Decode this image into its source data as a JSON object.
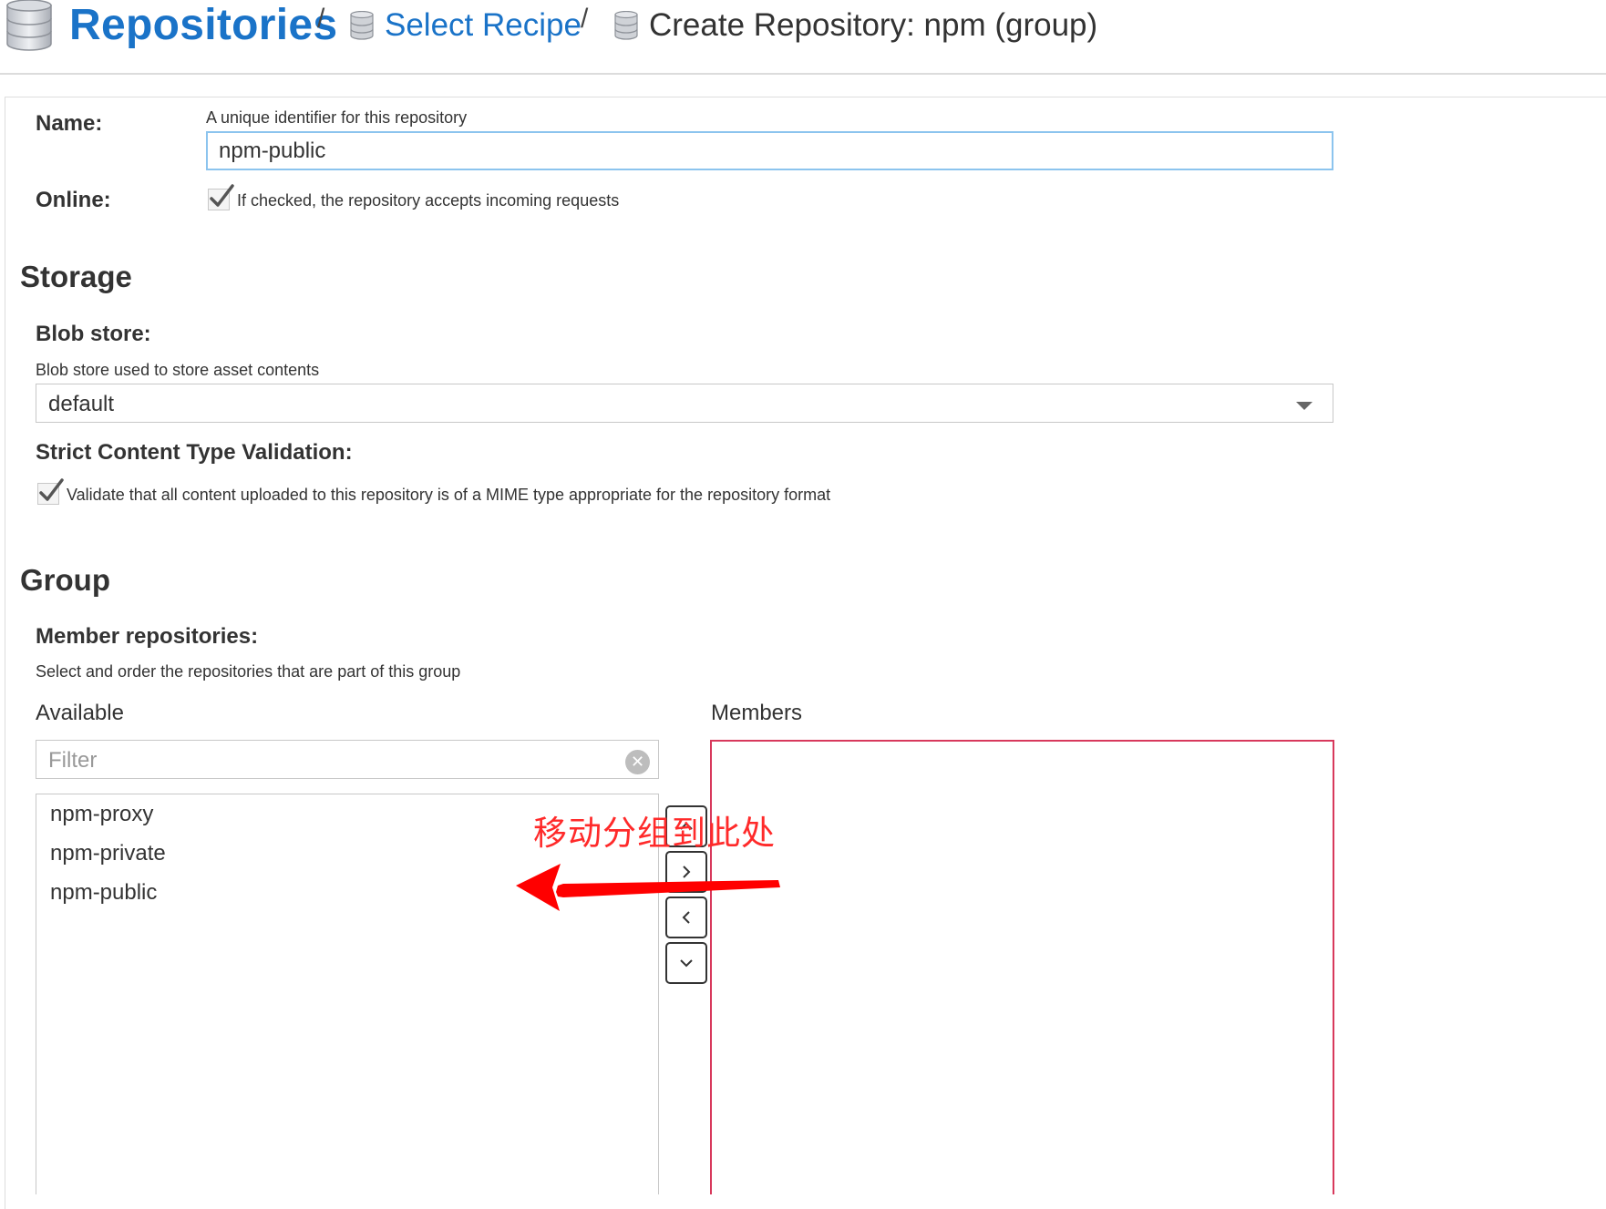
{
  "header": {
    "root": "Repositories",
    "separator": "/",
    "crumb1": "Select Recipe",
    "crumb2": "Create Repository: npm (group)"
  },
  "form": {
    "name_label": "Name:",
    "name_help": "A unique identifier for this repository",
    "name_value": "npm-public",
    "online_label": "Online:",
    "online_checked": true,
    "online_help": "If checked, the repository accepts incoming requests"
  },
  "storage": {
    "title": "Storage",
    "blob_label": "Blob store:",
    "blob_help": "Blob store used to store asset contents",
    "blob_value": "default",
    "strict_label": "Strict Content Type Validation:",
    "strict_checked": true,
    "strict_help": "Validate that all content uploaded to this repository is of a MIME type appropriate for the repository format"
  },
  "group": {
    "title": "Group",
    "members_label": "Member repositories:",
    "members_help": "Select and order the repositories that are part of this group",
    "available_label": "Available",
    "members_col_label": "Members",
    "filter_placeholder": "Filter",
    "available_items": [
      "npm-proxy",
      "npm-private",
      "npm-public"
    ],
    "members_items": []
  },
  "annotation": {
    "text": "移动分组到此处",
    "color": "#ff0000"
  },
  "colors": {
    "accent": "#1a73c8",
    "members_border": "#d8395c",
    "input_focus": "#8cc4ee"
  }
}
